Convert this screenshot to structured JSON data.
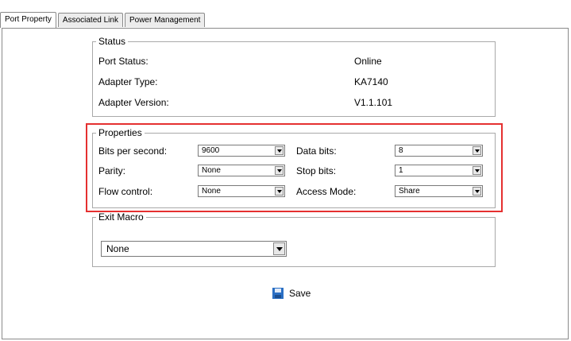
{
  "tabs": [
    {
      "label": "Port Property",
      "active": true
    },
    {
      "label": "Associated Link",
      "active": false
    },
    {
      "label": "Power Management",
      "active": false
    }
  ],
  "status": {
    "legend": "Status",
    "rows": [
      {
        "label": "Port Status:",
        "value": "Online"
      },
      {
        "label": "Adapter Type:",
        "value": "KA7140"
      },
      {
        "label": "Adapter Version:",
        "value": "V1.1.101"
      }
    ]
  },
  "properties": {
    "legend": "Properties",
    "bits_per_second": {
      "label": "Bits per second:",
      "value": "9600"
    },
    "parity": {
      "label": "Parity:",
      "value": "None"
    },
    "flow_control": {
      "label": "Flow control:",
      "value": "None"
    },
    "data_bits": {
      "label": "Data bits:",
      "value": "8"
    },
    "stop_bits": {
      "label": "Stop bits:",
      "value": "1"
    },
    "access_mode": {
      "label": "Access Mode:",
      "value": "Share"
    }
  },
  "exit_macro": {
    "legend": "Exit Macro",
    "value": "None"
  },
  "save_label": "Save",
  "colors": {
    "highlight_border": "#e53030",
    "save_icon": "#2a6fc4"
  }
}
